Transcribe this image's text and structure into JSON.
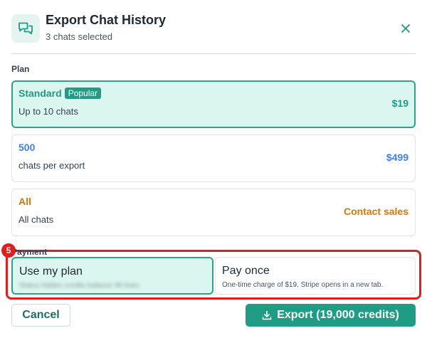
{
  "dialog": {
    "title": "Export Chat History",
    "subtitle": "3 chats selected"
  },
  "plan_section": {
    "label": "Plan",
    "options": [
      {
        "name": "Standard",
        "badge": "Popular",
        "description": "Up to 10 chats",
        "price": "$19",
        "selected": true,
        "color": "#1f9c84"
      },
      {
        "name": "500",
        "description": "chats per export",
        "price": "$499",
        "selected": false,
        "color": "#3b82f6"
      },
      {
        "name": "All",
        "description": "All chats",
        "price": "Contact sales",
        "selected": false,
        "color": "#d97706"
      }
    ]
  },
  "payment_section": {
    "label": "Payment",
    "marker": "5",
    "options": [
      {
        "title": "Use my plan",
        "subtitle": "Status hidden credits balance 99 lines",
        "selected": true
      },
      {
        "title": "Pay once",
        "subtitle": "One-time charge of $19. Stripe opens in a new tab.",
        "selected": false
      }
    ]
  },
  "footer": {
    "cancel_label": "Cancel",
    "export_label": "Export (19,000 credits)"
  },
  "colors": {
    "accent": "#1f9c84",
    "selected_bg": "#dbf6ee",
    "highlight": "#e11d1d"
  },
  "icons": {
    "header": "chat-bubbles-icon",
    "close": "close-icon",
    "export": "download-icon"
  }
}
